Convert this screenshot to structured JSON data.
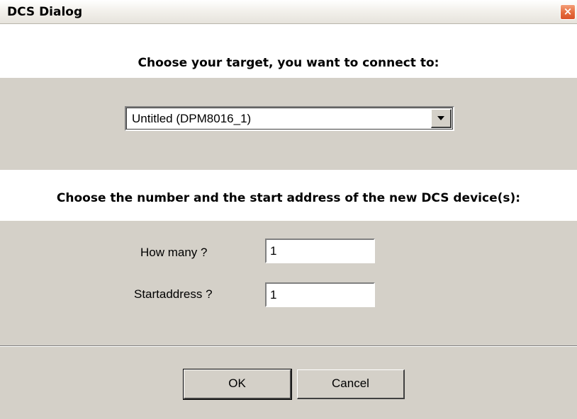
{
  "window": {
    "title": "DCS Dialog",
    "close_glyph": "×"
  },
  "target_section": {
    "heading": "Choose your target, you want to connect to:",
    "combo": {
      "selected_value": "Untitled (DPM8016_1)",
      "dropdown_icon": "chevron-down-icon"
    }
  },
  "device_section": {
    "heading": "Choose the number and the start address of the new DCS device(s):",
    "how_many": {
      "label": "How many ?",
      "value": "1"
    },
    "start_address": {
      "label": "Startaddress ?",
      "value": "1"
    }
  },
  "buttons": {
    "ok_label": "OK",
    "cancel_label": "Cancel"
  }
}
